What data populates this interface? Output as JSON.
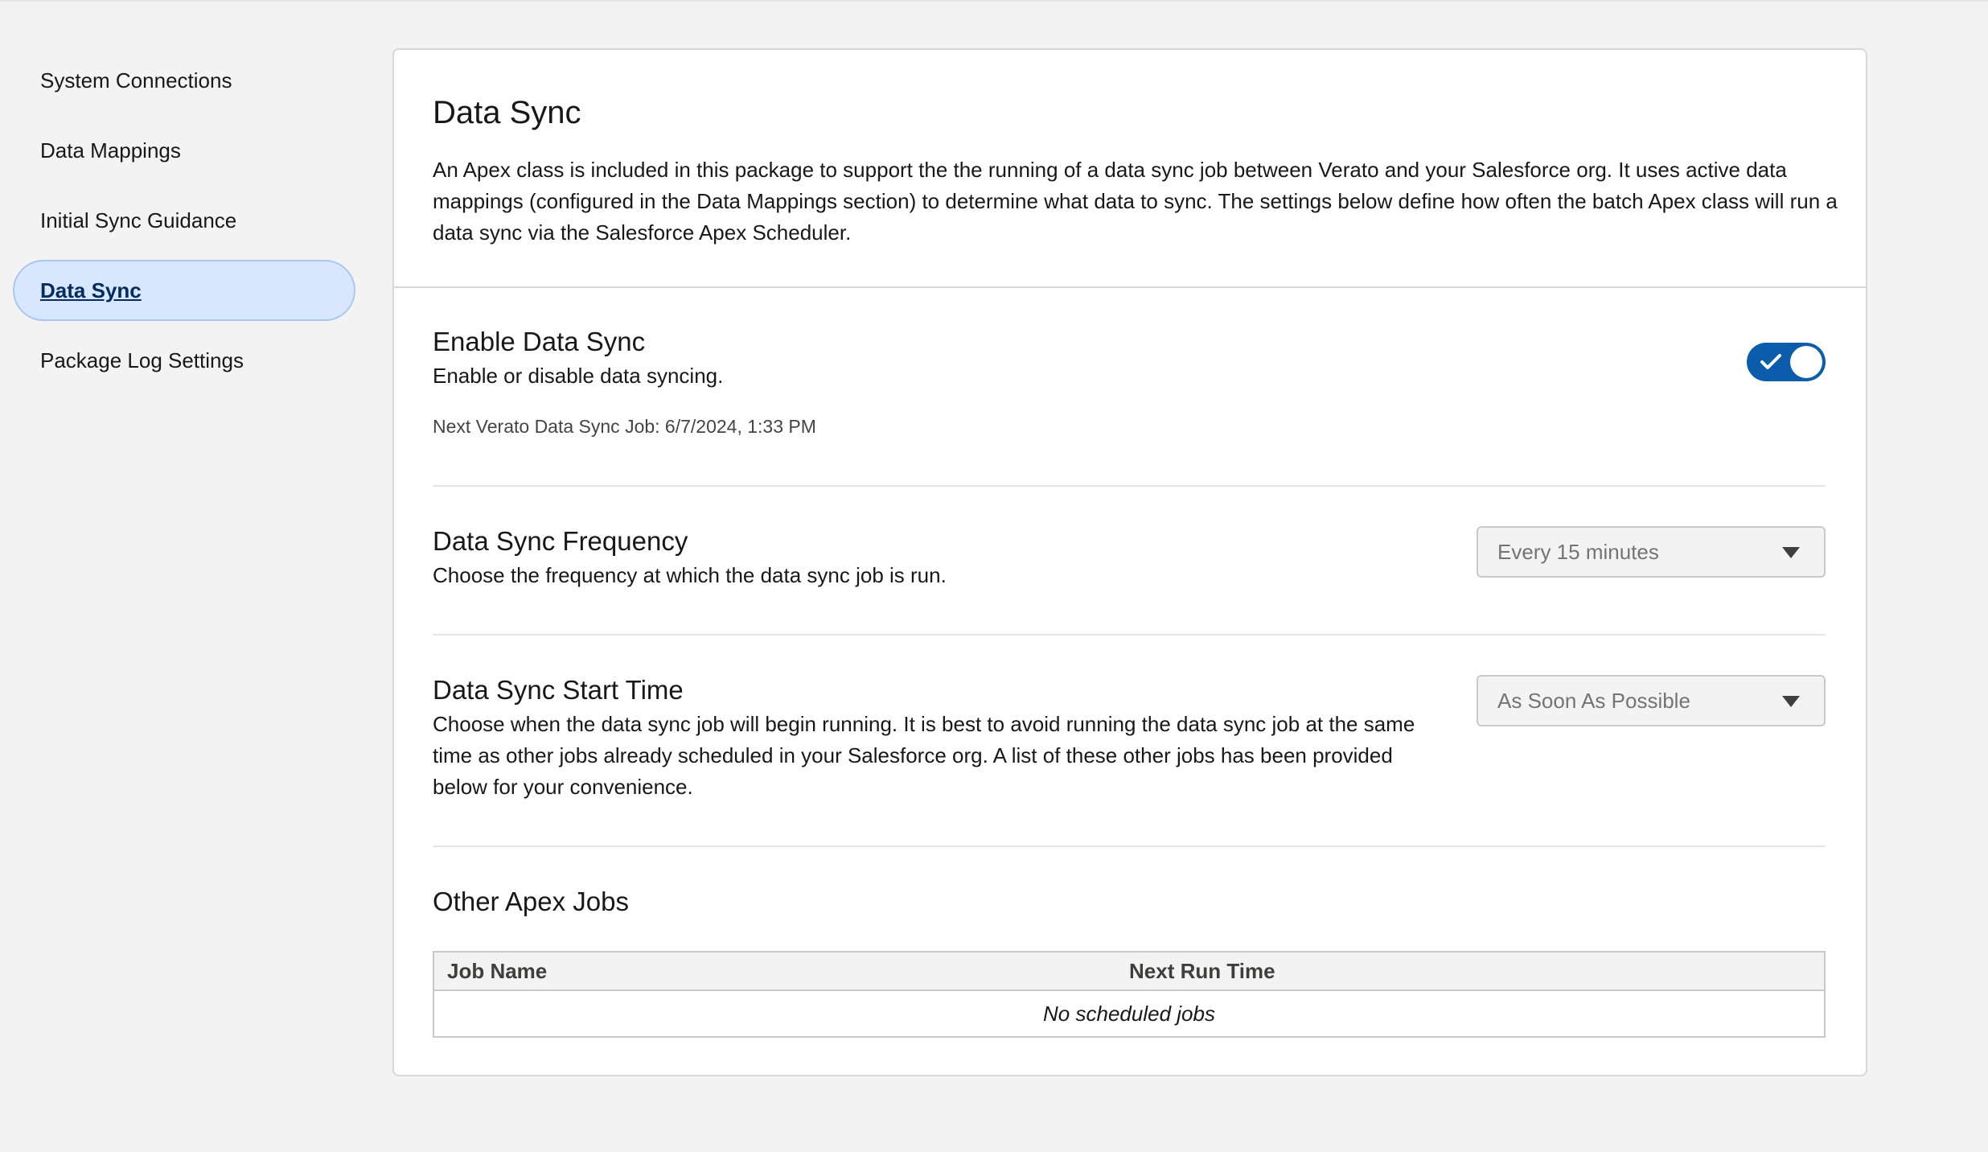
{
  "sidebar": {
    "items": [
      {
        "label": "System Connections",
        "active": false
      },
      {
        "label": "Data Mappings",
        "active": false
      },
      {
        "label": "Initial Sync Guidance",
        "active": false
      },
      {
        "label": "Data Sync",
        "active": true
      },
      {
        "label": "Package Log Settings",
        "active": false
      }
    ]
  },
  "header": {
    "title": "Data Sync",
    "description": "An Apex class is included in this package to support the the running of a data sync job between Verato and your Salesforce org. It uses active data mappings (configured in the Data Mappings section) to determine what data to sync. The settings below define how often the batch Apex class will run a data sync via the Salesforce Apex Scheduler."
  },
  "enable_sync": {
    "title": "Enable Data Sync",
    "description": "Enable or disable data syncing.",
    "next_job": "Next Verato Data Sync Job: 6/7/2024, 1:33 PM",
    "enabled": true,
    "toggle_icon": "check-icon"
  },
  "frequency": {
    "title": "Data Sync Frequency",
    "description": "Choose the frequency at which the data sync job is run.",
    "selected": "Every 15 minutes"
  },
  "start_time": {
    "title": "Data Sync Start Time",
    "description": "Choose when the data sync job will begin running. It is best to avoid running the data sync job at the same time as other jobs already scheduled in your Salesforce org. A list of these other jobs has been provided below for your convenience.",
    "selected": "As Soon As Possible"
  },
  "other_jobs": {
    "title": "Other Apex Jobs",
    "columns": [
      "Job Name",
      "Next Run Time"
    ],
    "empty_text": "No scheduled jobs"
  },
  "colors": {
    "accent": "#0b5cab",
    "active_nav_bg": "#d8e6fe",
    "page_bg": "#f3f3f3"
  }
}
